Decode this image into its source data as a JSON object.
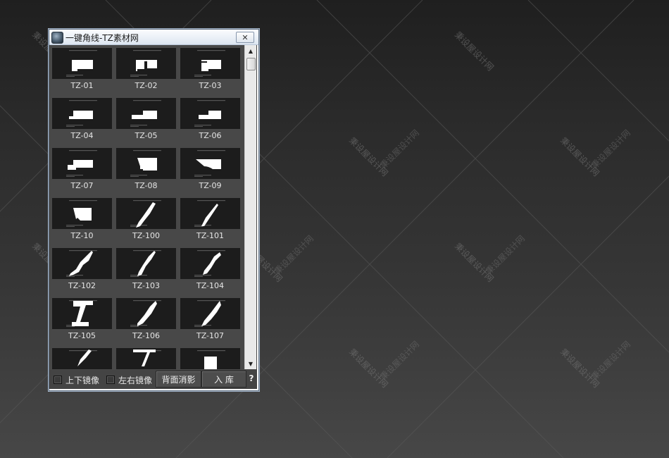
{
  "background": {
    "watermark": "秉设屋设计网"
  },
  "window": {
    "title": "一键角线-TZ素材网",
    "close_symbol": "✕",
    "tiles": [
      {
        "label": "TZ-01",
        "shape": "step-a"
      },
      {
        "label": "TZ-02",
        "shape": "step-b"
      },
      {
        "label": "TZ-03",
        "shape": "step-c"
      },
      {
        "label": "TZ-04",
        "shape": "step-d"
      },
      {
        "label": "TZ-05",
        "shape": "step-e"
      },
      {
        "label": "TZ-06",
        "shape": "step-f"
      },
      {
        "label": "TZ-07",
        "shape": "step-g"
      },
      {
        "label": "TZ-08",
        "shape": "step-h"
      },
      {
        "label": "TZ-09",
        "shape": "step-i"
      },
      {
        "label": "TZ-10",
        "shape": "step-j"
      },
      {
        "label": "TZ-100",
        "shape": "diag-a"
      },
      {
        "label": "TZ-101",
        "shape": "diag-b"
      },
      {
        "label": "TZ-102",
        "shape": "diag-c"
      },
      {
        "label": "TZ-103",
        "shape": "diag-d"
      },
      {
        "label": "TZ-104",
        "shape": "diag-e"
      },
      {
        "label": "TZ-105",
        "shape": "ibeam"
      },
      {
        "label": "TZ-106",
        "shape": "diag-f"
      },
      {
        "label": "TZ-107",
        "shape": "diag-g"
      },
      {
        "label": "",
        "shape": "partial-a"
      },
      {
        "label": "",
        "shape": "partial-b"
      },
      {
        "label": "",
        "shape": "partial-c"
      }
    ],
    "scroll_up_symbol": "▲",
    "scroll_down_symbol": "▼",
    "bottom": {
      "flip_vertical_label": "上下镜像",
      "flip_horizontal_label": "左右镜像",
      "back_shadow_label": "背面消影",
      "import_label": "入 库",
      "help_label": "?"
    }
  }
}
